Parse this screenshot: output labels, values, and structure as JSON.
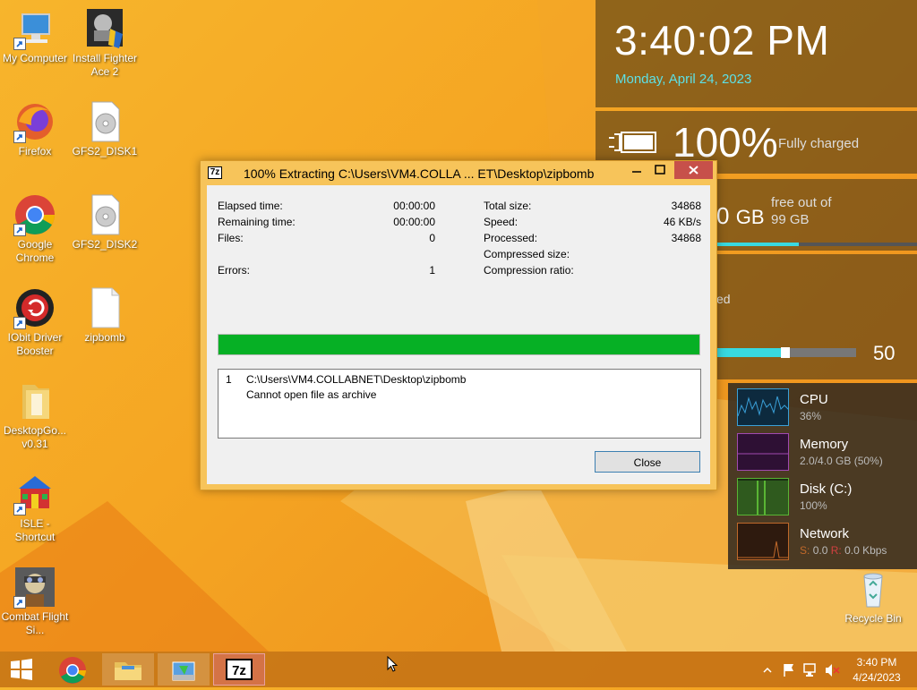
{
  "desktop": {
    "icons": [
      {
        "label": "My Computer",
        "icon": "computer-icon"
      },
      {
        "label": "Install Fighter Ace 2",
        "icon": "installer-icon"
      },
      {
        "label": "Firefox",
        "icon": "firefox-icon"
      },
      {
        "label": "GFS2_DISK1",
        "icon": "disc-file-icon"
      },
      {
        "label": "Google Chrome",
        "icon": "chrome-icon"
      },
      {
        "label": "GFS2_DISK2",
        "icon": "disc-file-icon"
      },
      {
        "label": "IObit Driver Booster",
        "icon": "driver-booster-icon"
      },
      {
        "label": "zipbomb",
        "icon": "blank-file-icon"
      },
      {
        "label": "DesktopGo... v0.31",
        "icon": "folder-icon"
      },
      {
        "label": "ISLE - Shortcut",
        "icon": "isle-icon"
      },
      {
        "label": "Combat Flight Si...",
        "icon": "combat-flight-icon"
      },
      {
        "label": "Recycle Bin",
        "icon": "recycle-bin-icon"
      }
    ]
  },
  "widgets": {
    "clock": {
      "time": "3:40:02 PM",
      "date": "Monday, April 24, 2023"
    },
    "battery": {
      "percent": "100%",
      "status": "Fully charged"
    },
    "disk": {
      "free_value": "0",
      "unit": "GB",
      "line1": "free out of",
      "line2": "99 GB",
      "used_fraction": 0.41
    },
    "volume": {
      "label_fragment": "ed",
      "value": "50",
      "level_fraction": 0.5
    },
    "perf": [
      {
        "name": "CPU",
        "value": "36%",
        "color": "#3aa0d8"
      },
      {
        "name": "Memory",
        "value": "2.0/4.0 GB (50%)",
        "color": "#a04ab0"
      },
      {
        "name": "Disk (C:)",
        "value": "100%",
        "color": "#59b534"
      },
      {
        "name": "Network",
        "value_s_label": "S:",
        "value_s": "0.0",
        "value_r_label": "R:",
        "value_r": "0.0 Kbps",
        "color": "#c0692a"
      }
    ]
  },
  "dialog": {
    "title": "100% Extracting C:\\Users\\VM4.COLLA ... ET\\Desktop\\zipbomb",
    "app_icon_text": "7z",
    "left_stats": [
      {
        "label": "Elapsed time:",
        "value": "00:00:00"
      },
      {
        "label": "Remaining time:",
        "value": "00:00:00"
      },
      {
        "label": "Files:",
        "value": "0"
      },
      {
        "label": "Errors:",
        "value": "1"
      }
    ],
    "right_stats": [
      {
        "label": "Total size:",
        "value": "34868"
      },
      {
        "label": "Speed:",
        "value": "46 KB/s"
      },
      {
        "label": "Processed:",
        "value": "34868"
      },
      {
        "label": "Compressed size:",
        "value": ""
      },
      {
        "label": "Compression ratio:",
        "value": ""
      }
    ],
    "progress_fraction": 1.0,
    "log": {
      "index": "1",
      "path": "C:\\Users\\VM4.COLLABNET\\Desktop\\zipbomb",
      "message": "Cannot open file as archive"
    },
    "close_label": "Close"
  },
  "taskbar": {
    "items": [
      "start-button",
      "chrome-taskbar",
      "file-explorer-taskbar",
      "installer-taskbar",
      "7zip-taskbar"
    ],
    "clock_time": "3:40 PM",
    "clock_date": "4/24/2023"
  }
}
